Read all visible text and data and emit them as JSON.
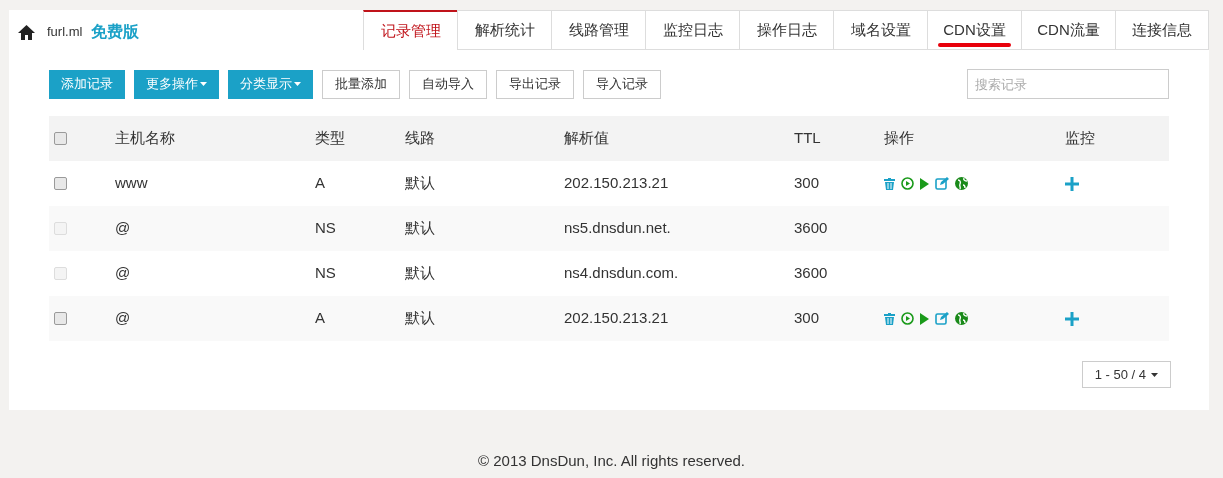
{
  "brand": {
    "domain": "furl.ml",
    "plan": "免费版"
  },
  "tabs": [
    {
      "label": "记录管理",
      "selected": true,
      "marked": false
    },
    {
      "label": "解析统计",
      "selected": false,
      "marked": false
    },
    {
      "label": "线路管理",
      "selected": false,
      "marked": false
    },
    {
      "label": "监控日志",
      "selected": false,
      "marked": false
    },
    {
      "label": "操作日志",
      "selected": false,
      "marked": false
    },
    {
      "label": "域名设置",
      "selected": false,
      "marked": false
    },
    {
      "label": "CDN设置",
      "selected": false,
      "marked": true
    },
    {
      "label": "CDN流量",
      "selected": false,
      "marked": false
    },
    {
      "label": "连接信息",
      "selected": false,
      "marked": false
    }
  ],
  "toolbar": [
    {
      "label": "添加记录",
      "kind": "primary"
    },
    {
      "label": "更多操作",
      "kind": "primary-dropdown"
    },
    {
      "label": "分类显示",
      "kind": "primary-dropdown"
    },
    {
      "label": "批量添加",
      "kind": "default"
    },
    {
      "label": "自动导入",
      "kind": "default"
    },
    {
      "label": "导出记录",
      "kind": "default"
    },
    {
      "label": "导入记录",
      "kind": "default"
    }
  ],
  "search": {
    "placeholder": "搜索记录"
  },
  "table": {
    "select_all_checked": false,
    "columns": [
      "主机名称",
      "类型",
      "线路",
      "解析值",
      "TTL",
      "操作",
      "监控"
    ],
    "rows": [
      {
        "host": "www",
        "type": "A",
        "line": "默认",
        "value": "202.150.213.21",
        "ttl": "300",
        "checked": false,
        "disabled": false,
        "editable": true
      },
      {
        "host": "@",
        "type": "NS",
        "line": "默认",
        "value": "ns5.dnsdun.net.",
        "ttl": "3600",
        "checked": false,
        "disabled": true,
        "editable": false
      },
      {
        "host": "@",
        "type": "NS",
        "line": "默认",
        "value": "ns4.dnsdun.com.",
        "ttl": "3600",
        "checked": false,
        "disabled": true,
        "editable": false
      },
      {
        "host": "@",
        "type": "A",
        "line": "默认",
        "value": "202.150.213.21",
        "ttl": "300",
        "checked": false,
        "disabled": false,
        "editable": true
      }
    ]
  },
  "pagination": {
    "label": "1 - 50 / 4"
  },
  "footer": "© 2013 DnsDun, Inc. All rights reserved."
}
